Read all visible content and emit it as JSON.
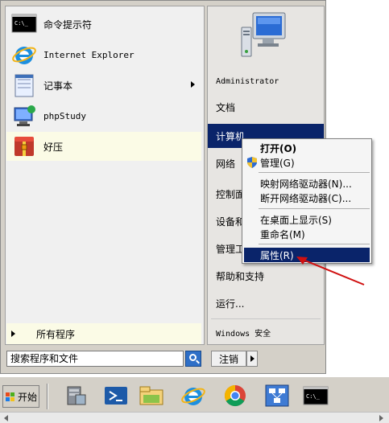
{
  "programs": [
    {
      "label": "命令提示符",
      "icon": "cmd-icon"
    },
    {
      "label": "Internet Explorer",
      "icon": "ie-icon"
    },
    {
      "label": "记事本",
      "icon": "notepad-icon"
    },
    {
      "label": "phpStudy",
      "icon": "phpstudy-icon"
    },
    {
      "label": "好压",
      "icon": "haozip-icon"
    }
  ],
  "all_programs_label": "所有程序",
  "search": {
    "placeholder": "搜索程序和文件",
    "value": "搜索程序和文件"
  },
  "right_items": [
    {
      "label": "Administrator"
    },
    {
      "label": "文档"
    },
    {
      "label": "计算机"
    },
    {
      "label": "网络"
    },
    {
      "label": "控制面板"
    },
    {
      "label": "设备和打印机"
    },
    {
      "label": "管理工具"
    },
    {
      "label": "帮助和支持"
    },
    {
      "label": "运行..."
    },
    {
      "label": "Windows 安全"
    }
  ],
  "right_items_visible": [
    "控制面",
    "设备和",
    "管理工"
  ],
  "logoff_label": "注销",
  "context_menu": {
    "items": [
      {
        "label": "打开(O)",
        "bold": true
      },
      {
        "label": "管理(G)",
        "icon": "shield-icon"
      },
      {
        "label": "映射网络驱动器(N)..."
      },
      {
        "label": "断开网络驱动器(C)..."
      },
      {
        "label": "在桌面上显示(S)"
      },
      {
        "label": "重命名(M)"
      },
      {
        "label": "属性(R)",
        "selected": true
      }
    ]
  },
  "taskbar": {
    "start_label": "开始",
    "buttons": [
      "server-manager-icon",
      "powershell-icon",
      "explorer-icon",
      "ie-icon",
      "chrome-icon",
      "network-icon",
      "cmd-icon"
    ]
  },
  "colors": {
    "selection": "#0a246a",
    "highlight_bg": "#fbfbe6",
    "annotation": "#d01010"
  }
}
